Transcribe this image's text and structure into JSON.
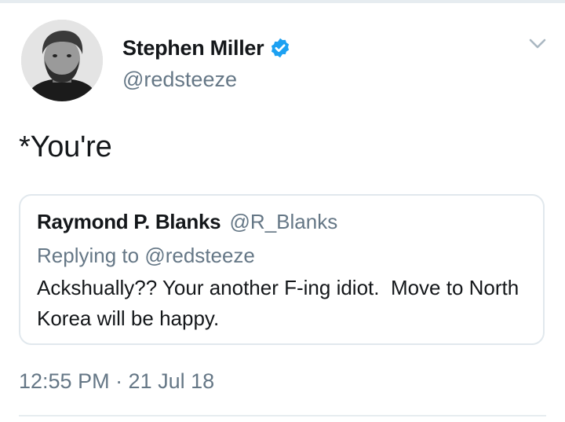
{
  "tweet": {
    "author": {
      "display_name": "Stephen Miller",
      "handle": "@redsteeze",
      "verified": true,
      "avatar_icon": "avatar-photo"
    },
    "text": "*You're",
    "menu_icon": "chevron-down-icon",
    "timestamp": "12:55 PM · 21 Jul 18"
  },
  "quoted_tweet": {
    "display_name": "Raymond P. Blanks",
    "handle": "@R_Blanks",
    "replying_prefix": "Replying to",
    "replying_to": "@redsteeze",
    "text": "Ackshually?? Your another F-ing idiot.  Move to North Korea will be happy."
  },
  "colors": {
    "verified_blue": "#1da1f2",
    "secondary_text": "#657786",
    "primary_text": "#14171a",
    "border": "#e1e8ed"
  }
}
